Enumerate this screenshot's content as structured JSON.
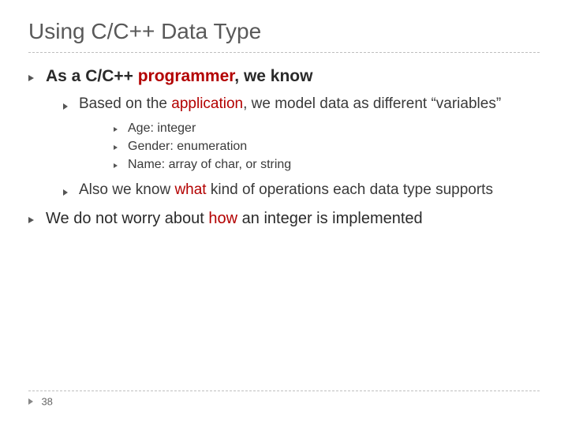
{
  "title": "Using C/C++ Data Type",
  "l1a": {
    "prefix": "As a C/C++ ",
    "hl": "programmer",
    "suffix": ", we know"
  },
  "l2a": {
    "prefix": "Based on the ",
    "hl": "application",
    "suffix": ",  we model data as different “variables”"
  },
  "l3items": [
    "Age: integer",
    "Gender: enumeration",
    "Name: array of char, or string"
  ],
  "l2b": {
    "prefix": "Also we know ",
    "hl": "what",
    "suffix": " kind of operations each data type supports"
  },
  "l1b": {
    "prefix": "We do not worry about ",
    "hl": "how",
    "suffix": " an integer is implemented"
  },
  "page_number": "38"
}
